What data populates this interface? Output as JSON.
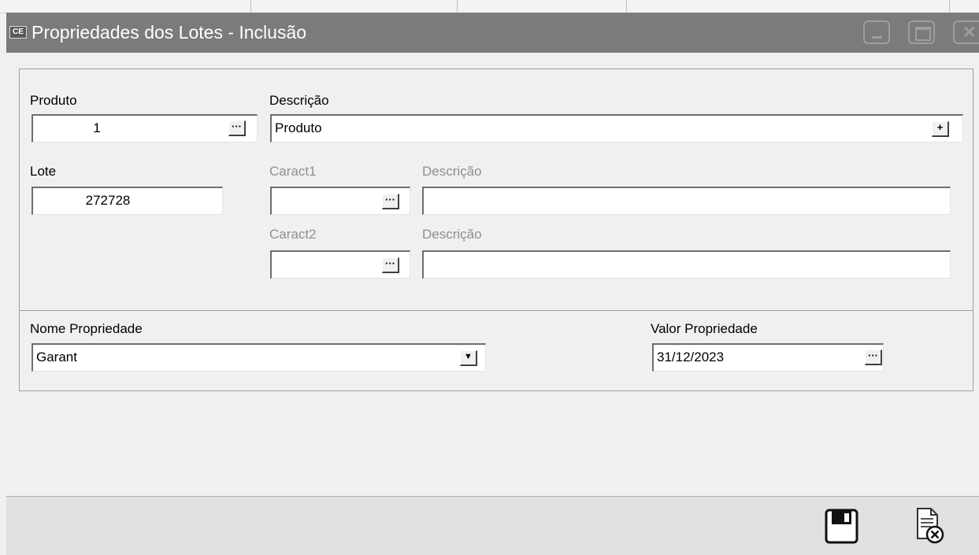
{
  "window": {
    "title": "Propriedades dos Lotes - Inclusão",
    "icon_text": "CE",
    "icons": [
      "minimize-icon",
      "maximize-icon",
      "close-icon"
    ]
  },
  "produto": {
    "label": "Produto",
    "value": "1",
    "lookup_button": "···"
  },
  "descricao": {
    "label": "Descrição",
    "value": "Produto",
    "add_button": "+"
  },
  "lote": {
    "label": "Lote",
    "value": "272728"
  },
  "caract1": {
    "label": "Caract1",
    "value": "",
    "lookup_button": "···",
    "desc_label": "Descrição",
    "desc_value": ""
  },
  "caract2": {
    "label": "Caract2",
    "value": "",
    "lookup_button": "···",
    "desc_label": "Descrição",
    "desc_value": ""
  },
  "nome_propriedade": {
    "label": "Nome Propriedade",
    "value": "Garant",
    "dropdown_icon": "▼"
  },
  "valor_propriedade": {
    "label": "Valor Propriedade",
    "value": "31/12/2023",
    "lookup_button": "···"
  },
  "footer": {
    "icons": [
      "save-icon",
      "cancel-document-icon"
    ]
  },
  "colors": {
    "titlebar": "#7b7b7b",
    "disabled_label": "#8f8f8f",
    "form_bg": "#f0f0f0"
  }
}
